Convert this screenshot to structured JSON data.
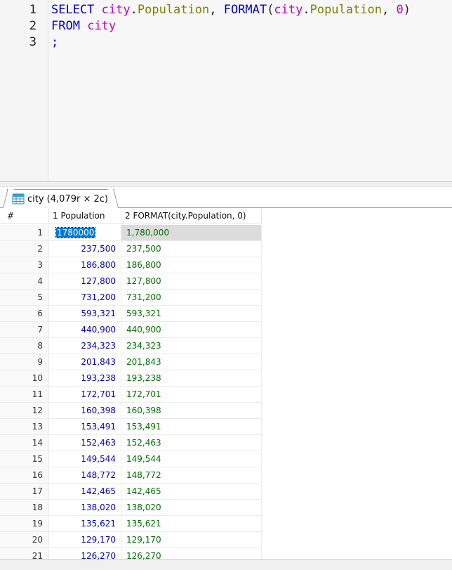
{
  "editor": {
    "line_numbers": [
      "1",
      "2",
      "3"
    ],
    "line1": {
      "select": "SELECT",
      "table1": "city",
      "dot1": ".",
      "field1": "Population",
      "comma1": ", ",
      "format": "FORMAT",
      "paren_open": "(",
      "table2": "city",
      "dot2": ".",
      "field2": "Population",
      "comma2": ", ",
      "zero": "0",
      "paren_close": ")"
    },
    "line2": {
      "from": "FROM",
      "table": "city"
    },
    "line3": {
      "semicolon": ";"
    }
  },
  "result_tab": {
    "label": "city (4,079r × 2c)",
    "icon": "table-grid-icon"
  },
  "grid": {
    "columns": {
      "rownum": "#",
      "col1": "1 Population",
      "col2": "2 FORMAT(city.Population, 0)"
    },
    "rows": [
      {
        "n": "1",
        "population": "1780000",
        "formatted": "1,780,000",
        "selected": true
      },
      {
        "n": "2",
        "population": "237,500",
        "formatted": "237,500"
      },
      {
        "n": "3",
        "population": "186,800",
        "formatted": "186,800"
      },
      {
        "n": "4",
        "population": "127,800",
        "formatted": "127,800"
      },
      {
        "n": "5",
        "population": "731,200",
        "formatted": "731,200"
      },
      {
        "n": "6",
        "population": "593,321",
        "formatted": "593,321"
      },
      {
        "n": "7",
        "population": "440,900",
        "formatted": "440,900"
      },
      {
        "n": "8",
        "population": "234,323",
        "formatted": "234,323"
      },
      {
        "n": "9",
        "population": "201,843",
        "formatted": "201,843"
      },
      {
        "n": "10",
        "population": "193,238",
        "formatted": "193,238"
      },
      {
        "n": "11",
        "population": "172,701",
        "formatted": "172,701"
      },
      {
        "n": "12",
        "population": "160,398",
        "formatted": "160,398"
      },
      {
        "n": "13",
        "population": "153,491",
        "formatted": "153,491"
      },
      {
        "n": "14",
        "population": "152,463",
        "formatted": "152,463"
      },
      {
        "n": "15",
        "population": "149,544",
        "formatted": "149,544"
      },
      {
        "n": "16",
        "population": "148,772",
        "formatted": "148,772"
      },
      {
        "n": "17",
        "population": "142,465",
        "formatted": "142,465"
      },
      {
        "n": "18",
        "population": "138,020",
        "formatted": "138,020"
      },
      {
        "n": "19",
        "population": "135,621",
        "formatted": "135,621"
      },
      {
        "n": "20",
        "population": "129,170",
        "formatted": "129,170"
      },
      {
        "n": "21",
        "population": "126,270",
        "formatted": "126,270"
      }
    ]
  },
  "colors": {
    "keyword": "#0000c8",
    "table": "#c000c0",
    "field": "#808000",
    "number_cell": "#0000c0",
    "text_cell": "#007000",
    "selection": "#0078d7"
  }
}
